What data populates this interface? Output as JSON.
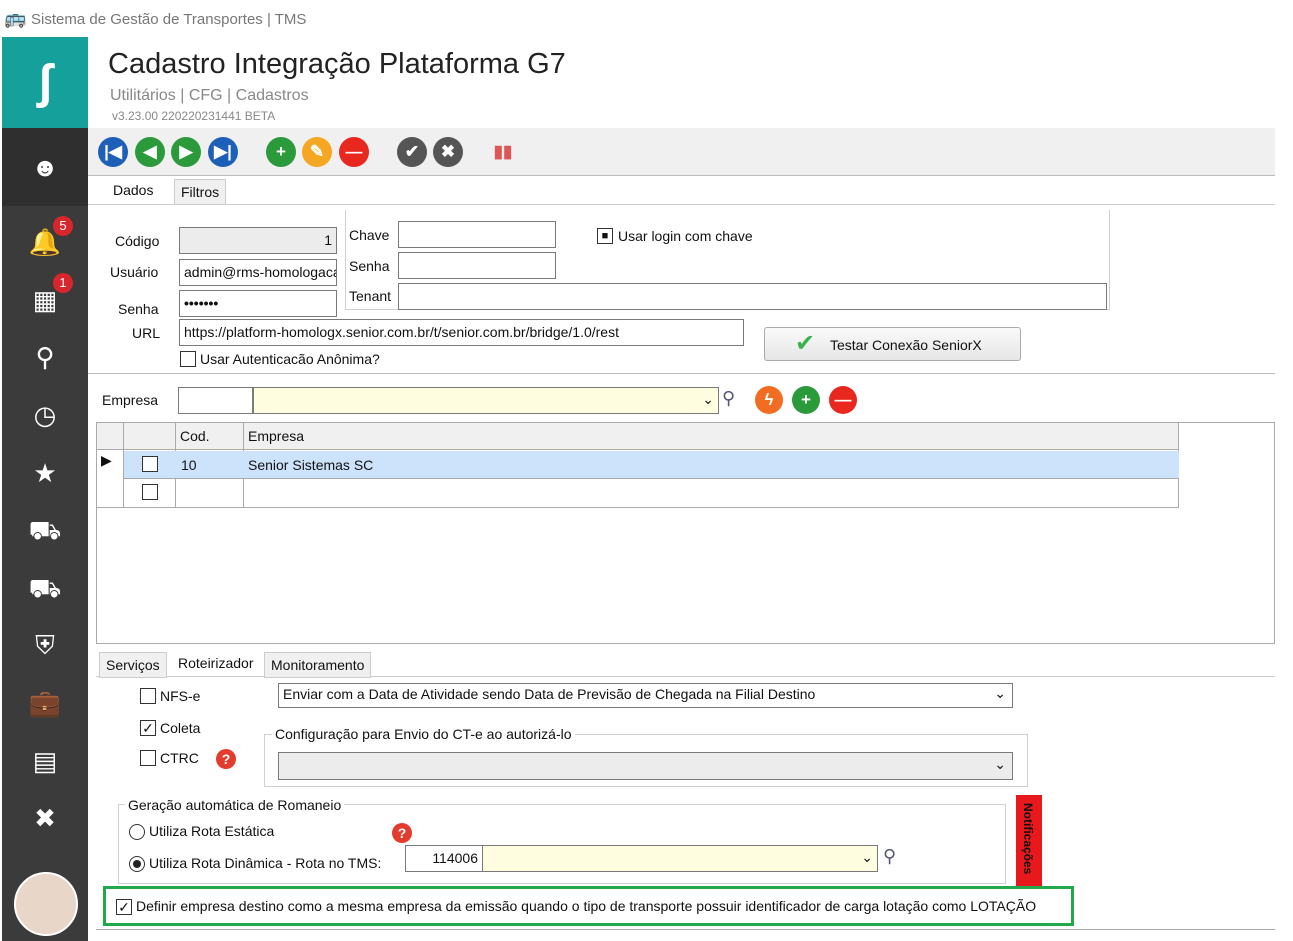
{
  "window": {
    "title": "Sistema de Gestão de Transportes | TMS"
  },
  "header": {
    "title": "Cadastro Integração Plataforma G7",
    "breadcrumb": "Utilitários | CFG | Cadastros",
    "version": "v3.23.00 220220231441 BETA"
  },
  "sidebar": {
    "notifications_badge": "5",
    "apps_badge": "1"
  },
  "tabs": {
    "dados": "Dados",
    "filtros": "Filtros"
  },
  "form": {
    "codigo_label": "Código",
    "codigo_value": "1",
    "usuario_label": "Usuário",
    "usuario_value": "admin@rms-homologacao",
    "senha_label": "Senha",
    "senha_value": "•••••••",
    "url_label": "URL",
    "url_value": "https://platform-homologx.senior.com.br/t/senior.com.br/bridge/1.0/rest",
    "anon_label": "Usar Autenticacão Anônima?",
    "chave_label": "Chave",
    "senha2_label": "Senha",
    "tenant_label": "Tenant",
    "usar_login_label": "Usar login com chave",
    "test_button": "Testar Conexão SeniorX"
  },
  "empresa": {
    "label": "Empresa",
    "columns": [
      "Cod.",
      "Empresa"
    ],
    "rows": [
      {
        "cod": "10",
        "empresa": "Senior Sistemas SC"
      }
    ]
  },
  "bottom_tabs": {
    "servicos": "Serviços",
    "roteirizador": "Roteirizador",
    "monitoramento": "Monitoramento"
  },
  "roteirizador": {
    "nfse": "NFS-e",
    "coleta": "Coleta",
    "ctrc": "CTRC",
    "data_atividade": "Enviar com a Data de Atividade sendo Data de Previsão de Chegada na Filial Destino",
    "config_group": "Configuração para Envio do CT-e ao autorizá-lo",
    "romaneio_group": "Geração automática de Romaneio",
    "rota_estatica": "Utiliza Rota Estática",
    "rota_dinamica": "Utiliza Rota Dinâmica - Rota no TMS:",
    "rota_code": "114006",
    "notificacoes": "Notificações",
    "definir_empresa": "Definir empresa destino como a mesma empresa da emissão quando o tipo de transporte possuir identificador de carga lotação como LOTAÇÃO"
  }
}
